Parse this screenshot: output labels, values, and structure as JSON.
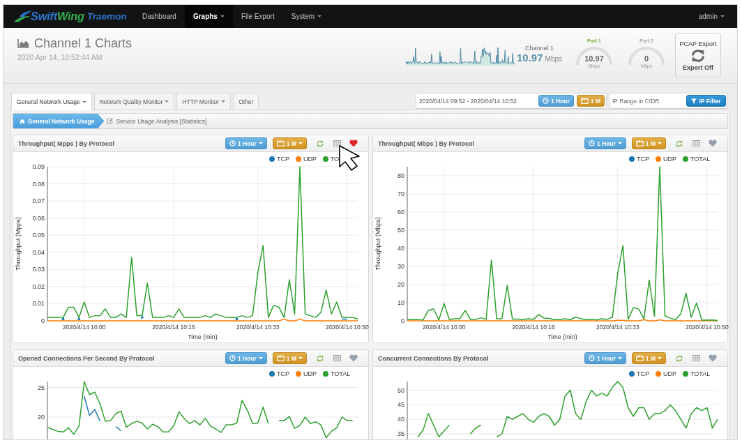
{
  "navbar": {
    "brand": {
      "parts": [
        "Swift",
        "Wing"
      ],
      "product": "Traemon"
    },
    "items": [
      {
        "label": "Dashboard",
        "selected": false,
        "dropdown": false
      },
      {
        "label": "Graphs",
        "selected": true,
        "dropdown": true
      },
      {
        "label": "File Export",
        "selected": false,
        "dropdown": false
      },
      {
        "label": "System",
        "selected": false,
        "dropdown": true
      }
    ],
    "user": {
      "label": "admin",
      "dropdown": true
    }
  },
  "header": {
    "title": "Channel 1 Charts",
    "timestamp": "2020 Apr 14, 10:52:44 AM",
    "channel": {
      "label": "Channel 1",
      "value": "10.97",
      "unit": "Mbps"
    },
    "ports": [
      {
        "label": "Port 1",
        "value": "10.97",
        "unit": "Mbps",
        "disabled": false
      },
      {
        "label": "Port 2",
        "value": "0",
        "unit": "Mbps",
        "disabled": true
      }
    ],
    "pcap_export": {
      "title": "PCAP Export",
      "status": "Export Off"
    }
  },
  "tabs": [
    {
      "label": "General Network Usage",
      "selected": true,
      "dropdown": true
    },
    {
      "label": "Network Quality Monitor",
      "selected": false,
      "dropdown": true
    },
    {
      "label": "HTTP Monitor",
      "selected": false,
      "dropdown": true
    },
    {
      "label": "Other",
      "selected": false,
      "dropdown": false
    }
  ],
  "filters": {
    "date_range": {
      "value": "2020/04/14 09:52 - 2020/04/14 10:52"
    },
    "period_button": "1 Hour",
    "interval_button": "1 M",
    "ip_range": {
      "placeholder": "IP Range in CIDR"
    },
    "ip_filter_button": "IP Filter"
  },
  "breadcrumb": [
    {
      "label": "General Network Usage",
      "selected": true
    },
    {
      "label": "Service Usage Analysis [Statistics]",
      "selected": false
    }
  ],
  "charts": [
    {
      "title": "Throughput( Mpps ) By Protocol",
      "period_button": "1 Hour",
      "interval_button": "1 M",
      "favorite": true,
      "chart_data": {
        "type": "line",
        "xlabel": "Time (min)",
        "ylabel": "Throughput (Mpps)",
        "grid": true,
        "legend": true,
        "categories": [
          null,
          null,
          null,
          null,
          null,
          null,
          null,
          "2020/4/14 10:00",
          null,
          null,
          null,
          null,
          null,
          null,
          null,
          null,
          null,
          null,
          null,
          null,
          null,
          null,
          null,
          null,
          "2020/4/14 10:16",
          null,
          null,
          null,
          null,
          null,
          null,
          null,
          null,
          null,
          null,
          null,
          null,
          null,
          null,
          null,
          "2020/4/14 10:33",
          null,
          null,
          null,
          null,
          null,
          null,
          null,
          null,
          null,
          null,
          null,
          null,
          null,
          null,
          null,
          null,
          "2020/4/14 10:50",
          null,
          null
        ],
        "ylim": [
          0,
          0.09
        ],
        "yticks": [
          {
            "value": 0,
            "label": "0"
          },
          0.01,
          0.02,
          0.03,
          0.04,
          0.05,
          0.06,
          0.07,
          0.08,
          0.09
        ],
        "series": [
          {
            "name": "TCP",
            "color": "#1f77b4",
            "values": [
              null,
              null,
              null,
              0.001,
              null,
              null,
              0.001,
              null,
              null,
              null,
              null,
              null,
              null,
              null,
              null,
              null,
              null,
              null,
              0.002,
              null,
              null,
              null,
              null,
              null,
              null,
              null,
              null,
              null,
              null,
              null,
              null,
              null,
              null,
              null,
              null,
              null,
              0.001,
              null,
              null,
              null,
              null,
              null,
              null,
              null,
              null,
              null,
              null,
              null,
              null,
              null,
              null,
              null,
              null,
              null,
              null,
              null,
              0.001,
              0.001,
              null,
              null
            ]
          },
          {
            "name": "UDP",
            "color": "#ff7f0e",
            "values": [
              0,
              0,
              0,
              0,
              0,
              0,
              0,
              0,
              0,
              0,
              0,
              0,
              0,
              0,
              0,
              0,
              0,
              0,
              0,
              0,
              0,
              0,
              0,
              0,
              0,
              0,
              0,
              0,
              0,
              0,
              0,
              0,
              0,
              0,
              0,
              0,
              0,
              0,
              0,
              0,
              0,
              0,
              0,
              0,
              0,
              0.001,
              0,
              0,
              0.001,
              0,
              0,
              0,
              0,
              0,
              0,
              0,
              0,
              0,
              0,
              0
            ]
          },
          {
            "name": "TO",
            "color": "#2ca02c",
            "values": [
              0.002,
              0.002,
              0.002,
              0.002,
              0.008,
              0.008,
              0.002,
              0.011,
              0.002,
              0.003,
              0.003,
              0.007,
              0.002,
              0.002,
              0.004,
              0.002,
              0.037,
              0.003,
              0.003,
              0.022,
              0.002,
              0.002,
              0.002,
              0.003,
              0.002,
              0.007,
              0.002,
              0.002,
              0.002,
              0.002,
              0.003,
              0.002,
              0.004,
              0.003,
              0.002,
              0.002,
              0.002,
              0.003,
              0.002,
              0.003,
              0.028,
              0.044,
              0.002,
              0.009,
              0.008,
              0.002,
              0.024,
              0.004,
              0.09,
              0.004,
              0.003,
              0.002,
              0.005,
              0.018,
              0.004,
              0.011,
              0.002,
              0.002,
              0.002,
              0.001
            ]
          }
        ]
      }
    },
    {
      "title": "Throughput( Mbps ) By Protocol",
      "period_button": "1 Hour",
      "interval_button": "1 M",
      "favorite": false,
      "chart_data": {
        "type": "line",
        "xlabel": "Time (min)",
        "ylabel": "Throughput (Mbps)",
        "grid": true,
        "legend": true,
        "categories": [
          null,
          null,
          null,
          null,
          null,
          null,
          null,
          "2020/4/14 10:00",
          null,
          null,
          null,
          null,
          null,
          null,
          null,
          null,
          null,
          null,
          null,
          null,
          null,
          null,
          null,
          null,
          "2020/4/14 10:16",
          null,
          null,
          null,
          null,
          null,
          null,
          null,
          null,
          null,
          null,
          null,
          null,
          null,
          null,
          null,
          "2020/4/14 10:33",
          null,
          null,
          null,
          null,
          null,
          null,
          null,
          null,
          null,
          null,
          null,
          null,
          null,
          null,
          null,
          null,
          "2020/4/14 10:50",
          null,
          null
        ],
        "ylim": [
          0,
          85
        ],
        "yticks": [
          {
            "value": 0,
            "label": "0"
          },
          10,
          20,
          30,
          40,
          50,
          60,
          70,
          80
        ],
        "series": [
          {
            "name": "TCP",
            "color": "#1f77b4",
            "values": [
              null,
              null,
              null,
              null,
              null,
              null,
              null,
              null,
              null,
              null,
              null,
              null,
              null,
              null,
              null,
              null,
              null,
              null,
              null,
              null,
              null,
              null,
              null,
              null,
              null,
              null,
              null,
              null,
              null,
              null,
              null,
              null,
              null,
              null,
              null,
              null,
              null,
              null,
              null,
              null,
              null,
              null,
              null,
              null,
              null,
              null,
              null,
              null,
              null,
              null,
              null,
              null,
              null,
              null,
              null,
              null,
              null,
              null,
              null,
              null
            ]
          },
          {
            "name": "UDP",
            "color": "#ff7f0e",
            "values": [
              0,
              0,
              0,
              0,
              0,
              0,
              0,
              0,
              0,
              0,
              0,
              0,
              0,
              0,
              0,
              0,
              0,
              0,
              0,
              0,
              0,
              0,
              0,
              0,
              0,
              0,
              0,
              0,
              0,
              0,
              0,
              0,
              0,
              0,
              0,
              0,
              0,
              0,
              0,
              0,
              0.3,
              0.3,
              0,
              0,
              0,
              0.7,
              0,
              0,
              0.6,
              0,
              0,
              0,
              0,
              0,
              0,
              0,
              0,
              0,
              0,
              0
            ]
          },
          {
            "name": "TOTAL",
            "color": "#2ca02c",
            "values": [
              1,
              0.7,
              0.7,
              0.5,
              5.7,
              6.6,
              0.5,
              9.5,
              0.8,
              1.2,
              1.2,
              5.7,
              0.8,
              0.8,
              1.7,
              0.8,
              33.5,
              1.2,
              1.2,
              19.5,
              1,
              1,
              0.8,
              1.2,
              0.8,
              3.5,
              1.5,
              1.3,
              0.7,
              0.7,
              1.2,
              0.7,
              2,
              1.2,
              0.7,
              1,
              0.5,
              1.2,
              0.8,
              2,
              26,
              41.5,
              0.8,
              7.3,
              6.5,
              1,
              22.5,
              2.5,
              85,
              2.8,
              1.5,
              0.7,
              3.8,
              15.2,
              2,
              9.8,
              0.4,
              0.4,
              0.5,
              0.2
            ]
          }
        ]
      }
    },
    {
      "title": "Opened Connections Per Second By Protocol",
      "period_button": "1 Hour",
      "interval_button": "1 M",
      "favorite": false,
      "chart_data": {
        "type": "line",
        "grid": true,
        "legend": true,
        "categories": [
          null,
          null,
          null,
          null,
          null,
          null,
          null,
          null,
          null,
          null,
          null,
          null,
          null,
          null,
          null,
          null,
          null,
          null,
          null,
          null,
          null,
          null,
          null,
          null,
          null,
          null,
          null,
          null,
          null,
          null,
          null,
          null,
          null,
          null,
          null,
          null,
          null,
          null,
          null,
          null,
          null,
          null,
          null,
          null,
          null,
          null,
          null,
          null,
          null,
          null,
          null,
          null,
          null,
          null,
          null,
          null,
          null,
          null,
          null,
          null
        ],
        "ylim": [
          0,
          26
        ],
        "yticks": [
          20,
          25
        ],
        "series": [
          {
            "name": "TCP",
            "color": "#1f77b4",
            "values": [
              null,
              null,
              null,
              null,
              null,
              null,
              null,
              23.5,
              20.3,
              21.3,
              19.3,
              null,
              null,
              18.4,
              17.7,
              null,
              null,
              null,
              null,
              null,
              null,
              null,
              null,
              null,
              null,
              null,
              null,
              null,
              null,
              null,
              null,
              null,
              null,
              null,
              null,
              null,
              null,
              null,
              null,
              null,
              null,
              null,
              null,
              null,
              null,
              null,
              null,
              null,
              null,
              null,
              null,
              null,
              null,
              null,
              null,
              null,
              null,
              null,
              null,
              null
            ]
          },
          {
            "name": "UDP",
            "color": "#ff7f0e",
            "values": [
              null,
              null,
              null,
              null,
              null,
              null,
              null,
              null,
              null,
              null,
              null,
              null,
              null,
              null,
              null,
              null,
              null,
              null,
              null,
              null,
              null,
              null,
              null,
              null,
              null,
              null,
              null,
              null,
              null,
              null,
              null,
              null,
              null,
              null,
              null,
              null,
              null,
              null,
              null,
              null,
              null,
              null,
              null,
              null,
              null,
              null,
              null,
              null,
              null,
              null,
              null,
              null,
              null,
              null,
              null,
              null,
              null,
              null,
              null,
              null
            ]
          },
          {
            "name": "TOTAL",
            "color": "#2ca02c",
            "values": [
              18.3,
              17.9,
              17.6,
              17.5,
              18.2,
              17.1,
              18.5,
              26,
              23.8,
              24.2,
              22.2,
              19.3,
              19.4,
              20.6,
              21,
              18.3,
              18.9,
              19.3,
              19,
              18,
              18.8,
              18.4,
              17.5,
              17.5,
              18.5,
              20.9,
              19.8,
              18.9,
              19.4,
              18.7,
              19.8,
              18.5,
              18,
              17.4,
              18.7,
              18.7,
              19,
              22.8,
              21.2,
              18.9,
              19,
              21.7,
              18.9,
              null,
              19.4,
              19.4,
              20.1,
              18.1,
              18.6,
              20,
              18.9,
              19.2,
              18.7,
              16.5,
              17.6,
              18.2,
              20,
              19.4,
              19.4,
              null
            ]
          }
        ]
      }
    },
    {
      "title": "Concurrent Connections By Protocol",
      "period_button": "1 Hour",
      "interval_button": "1 M",
      "favorite": false,
      "chart_data": {
        "type": "line",
        "grid": true,
        "legend": true,
        "categories": [
          null,
          null,
          null,
          null,
          null,
          null,
          null,
          null,
          null,
          null,
          null,
          null,
          null,
          null,
          null,
          null,
          null,
          null,
          null,
          null,
          null,
          null,
          null,
          null,
          null,
          null,
          null,
          null,
          null,
          null,
          null,
          null,
          null,
          null,
          null,
          null,
          null,
          null,
          null,
          null,
          null,
          null,
          null,
          null,
          null,
          null,
          null,
          null,
          null,
          null,
          null,
          null,
          null,
          null,
          null,
          null,
          null,
          null,
          null,
          null
        ],
        "ylim": [
          0,
          53
        ],
        "yticks": [
          35,
          40,
          45,
          50
        ],
        "series": [
          {
            "name": "TCP",
            "color": "#1f77b4",
            "values": [
              null,
              null,
              null,
              null,
              null,
              null,
              null,
              null,
              null,
              null,
              null,
              null,
              null,
              null,
              null,
              null,
              null,
              null,
              null,
              null,
              null,
              null,
              null,
              null,
              null,
              null,
              null,
              null,
              null,
              null,
              null,
              null,
              null,
              null,
              null,
              null,
              null,
              null,
              null,
              null,
              null,
              null,
              null,
              null,
              null,
              null,
              null,
              null,
              null,
              null,
              null,
              null,
              null,
              null,
              null,
              null,
              null,
              null,
              null,
              null
            ]
          },
          {
            "name": "UDP",
            "color": "#ff7f0e",
            "values": [
              null,
              null,
              null,
              null,
              null,
              null,
              null,
              null,
              null,
              null,
              null,
              null,
              null,
              null,
              null,
              null,
              null,
              null,
              null,
              null,
              null,
              null,
              null,
              null,
              null,
              null,
              null,
              null,
              null,
              null,
              null,
              null,
              null,
              null,
              null,
              null,
              null,
              null,
              null,
              null,
              null,
              null,
              null,
              null,
              null,
              null,
              null,
              null,
              null,
              null,
              null,
              null,
              null,
              null,
              null,
              null,
              null,
              null,
              null,
              null
            ]
          },
          {
            "name": "TOTAL",
            "color": "#2ca02c",
            "values": [
              null,
              null,
              34,
              36.2,
              42,
              38,
              34,
              36,
              38,
              null,
              null,
              null,
              35,
              37,
              38,
              null,
              null,
              34,
              35,
              41,
              40,
              41,
              42,
              40,
              39,
              41,
              42,
              41,
              38,
              40,
              48,
              50,
              42,
              40,
              46,
              50,
              48,
              49,
              48,
              51,
              53,
              51,
              44,
              41,
              44,
              44,
              40,
              42,
              42,
              43,
              45,
              43,
              40,
              37,
              42,
              44,
              43,
              44,
              37,
              40
            ]
          }
        ]
      }
    }
  ]
}
